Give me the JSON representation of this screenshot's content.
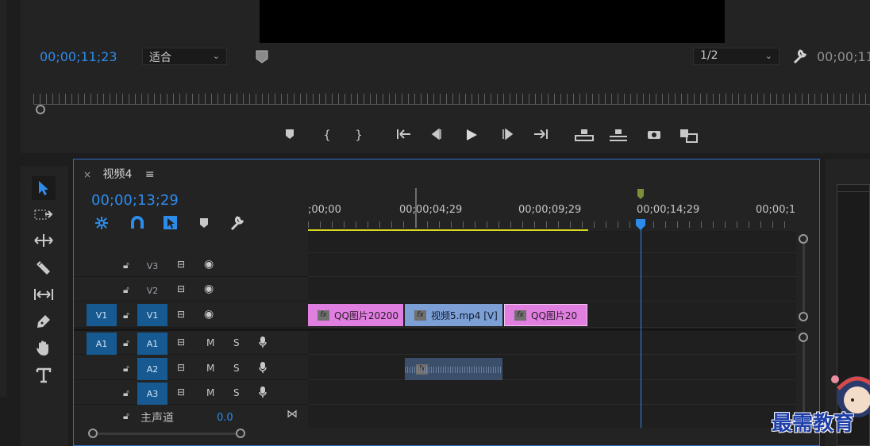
{
  "monitor": {
    "timecode_left": "00;00;11;23",
    "zoom_select": "适合",
    "resolution_select": "1/2",
    "timecode_right": "00;00;11"
  },
  "timeline": {
    "tab_title": "视频4",
    "current_timecode": "00;00;13;29",
    "ruler_labels": [
      ";00;00",
      "00;00;04;29",
      "00;00;09;29",
      "00;00;14;29",
      "00;00;1!"
    ],
    "video_tracks": [
      {
        "name": "V3",
        "source": ""
      },
      {
        "name": "V2",
        "source": ""
      },
      {
        "name": "V1",
        "source": "V1"
      }
    ],
    "audio_tracks": [
      {
        "name": "A1",
        "source": "A1",
        "m": "M",
        "s": "S"
      },
      {
        "name": "A2",
        "source": "",
        "m": "M",
        "s": "S"
      },
      {
        "name": "A3",
        "source": "",
        "m": "M",
        "s": "S"
      }
    ],
    "master": {
      "label": "主声道",
      "value": "0.0"
    },
    "clips_v1": [
      {
        "label": "QQ图片20200",
        "color": "#e07fe0"
      },
      {
        "label": "视频5.mp4 [V]",
        "color": "#7c9fd6"
      },
      {
        "label": "QQ图片20",
        "color": "#e07fe0"
      }
    ]
  },
  "watermark": {
    "text": "最需教育"
  },
  "colors": {
    "accent": "#2d8ceb",
    "track_active": "#175a91",
    "work_area": "#d8d820"
  }
}
